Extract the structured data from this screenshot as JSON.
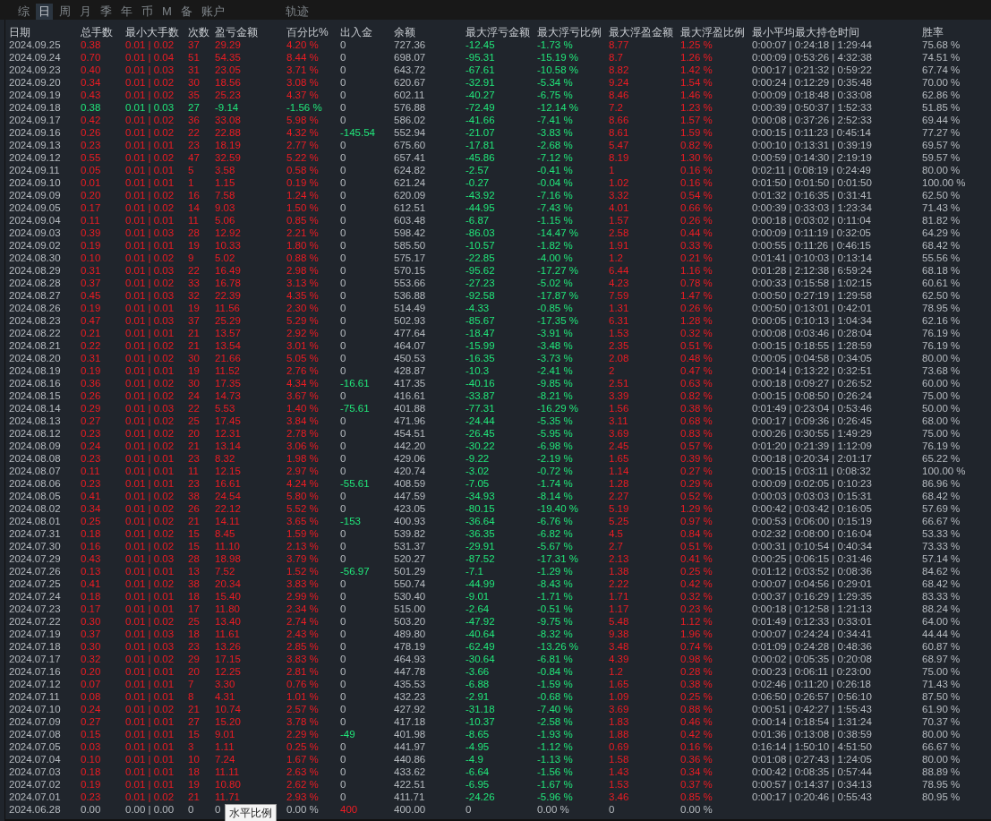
{
  "tabs": [
    {
      "label": "综",
      "selected": false
    },
    {
      "label": "日",
      "selected": true
    },
    {
      "label": "周",
      "selected": false
    },
    {
      "label": "月",
      "selected": false
    },
    {
      "label": "季",
      "selected": false
    },
    {
      "label": "年",
      "selected": false
    },
    {
      "label": "币",
      "selected": false
    },
    {
      "label": "M",
      "selected": false
    },
    {
      "label": "备",
      "selected": false
    },
    {
      "label": "账户",
      "selected": false
    },
    {
      "label": "轨迹",
      "selected": false
    }
  ],
  "table": {
    "columns": [
      "日期",
      "总手数",
      "最小大手数",
      "次数",
      "盈亏金额",
      "百分比%",
      "出入金",
      "余额",
      "最大浮亏金额",
      "最大浮亏比例",
      "最大浮盈金额",
      "最大浮盈比例",
      "最小平均最大持仓时间",
      "胜率"
    ],
    "rows": [
      {
        "loss": false,
        "flat": false,
        "withdrawal": false,
        "deposit": false,
        "cells": [
          "2024.09.25",
          "0.38",
          "0.01 | 0.02",
          "37",
          "29.29",
          "4.20 %",
          "0",
          "727.36",
          "-12.45",
          "-1.73 %",
          "8.77",
          "1.25 %",
          "0:00:07 | 0:24:18 | 1:29:44",
          "75.68 %"
        ]
      },
      {
        "loss": false,
        "flat": false,
        "withdrawal": false,
        "deposit": false,
        "cells": [
          "2024.09.24",
          "0.70",
          "0.01 | 0.04",
          "51",
          "54.35",
          "8.44 %",
          "0",
          "698.07",
          "-95.31",
          "-15.19 %",
          "8.7",
          "1.26 %",
          "0:00:09 | 0:53:26 | 4:32:38",
          "74.51 %"
        ]
      },
      {
        "loss": false,
        "flat": false,
        "withdrawal": false,
        "deposit": false,
        "cells": [
          "2024.09.23",
          "0.40",
          "0.01 | 0.03",
          "31",
          "23.05",
          "3.71 %",
          "0",
          "643.72",
          "-67.61",
          "-10.58 %",
          "8.82",
          "1.42 %",
          "0:00:17 | 0:21:32 | 0:59:22",
          "67.74 %"
        ]
      },
      {
        "loss": false,
        "flat": false,
        "withdrawal": false,
        "deposit": false,
        "cells": [
          "2024.09.20",
          "0.34",
          "0.01 | 0.02",
          "30",
          "18.56",
          "3.08 %",
          "0",
          "620.67",
          "-32.91",
          "-5.34 %",
          "9.24",
          "1.54 %",
          "0:00:24 | 0:12:29 | 0:35:48",
          "70.00 %"
        ]
      },
      {
        "loss": false,
        "flat": false,
        "withdrawal": false,
        "deposit": false,
        "cells": [
          "2024.09.19",
          "0.43",
          "0.01 | 0.02",
          "35",
          "25.23",
          "4.37 %",
          "0",
          "602.11",
          "-40.27",
          "-6.75 %",
          "8.46",
          "1.46 %",
          "0:00:09 | 0:18:48 | 0:33:08",
          "62.86 %"
        ]
      },
      {
        "loss": true,
        "flat": false,
        "withdrawal": false,
        "deposit": false,
        "cells": [
          "2024.09.18",
          "0.38",
          "0.01 | 0.03",
          "27",
          "-9.14",
          "-1.56 %",
          "0",
          "576.88",
          "-72.49",
          "-12.14 %",
          "7.2",
          "1.23 %",
          "0:00:39 | 0:50:37 | 1:52:33",
          "51.85 %"
        ]
      },
      {
        "loss": false,
        "flat": false,
        "withdrawal": false,
        "deposit": false,
        "cells": [
          "2024.09.17",
          "0.42",
          "0.01 | 0.02",
          "36",
          "33.08",
          "5.98 %",
          "0",
          "586.02",
          "-41.66",
          "-7.41 %",
          "8.66",
          "1.57 %",
          "0:00:08 | 0:37:26 | 2:52:33",
          "69.44 %"
        ]
      },
      {
        "loss": false,
        "flat": false,
        "withdrawal": true,
        "deposit": false,
        "cells": [
          "2024.09.16",
          "0.26",
          "0.01 | 0.02",
          "22",
          "22.88",
          "4.32 %",
          "-145.54",
          "552.94",
          "-21.07",
          "-3.83 %",
          "8.61",
          "1.59 %",
          "0:00:15 | 0:11:23 | 0:45:14",
          "77.27 %"
        ]
      },
      {
        "loss": false,
        "flat": false,
        "withdrawal": false,
        "deposit": false,
        "cells": [
          "2024.09.13",
          "0.23",
          "0.01 | 0.01",
          "23",
          "18.19",
          "2.77 %",
          "0",
          "675.60",
          "-17.81",
          "-2.68 %",
          "5.47",
          "0.82 %",
          "0:00:10 | 0:13:31 | 0:39:19",
          "69.57 %"
        ]
      },
      {
        "loss": false,
        "flat": false,
        "withdrawal": false,
        "deposit": false,
        "cells": [
          "2024.09.12",
          "0.55",
          "0.01 | 0.02",
          "47",
          "32.59",
          "5.22 %",
          "0",
          "657.41",
          "-45.86",
          "-7.12 %",
          "8.19",
          "1.30 %",
          "0:00:59 | 0:14:30 | 2:19:19",
          "59.57 %"
        ]
      },
      {
        "loss": false,
        "flat": false,
        "withdrawal": false,
        "deposit": false,
        "cells": [
          "2024.09.11",
          "0.05",
          "0.01 | 0.01",
          "5",
          "3.58",
          "0.58 %",
          "0",
          "624.82",
          "-2.57",
          "-0.41 %",
          "1",
          "0.16 %",
          "0:02:11 | 0:08:19 | 0:24:49",
          "80.00 %"
        ]
      },
      {
        "loss": false,
        "flat": false,
        "withdrawal": false,
        "deposit": false,
        "cells": [
          "2024.09.10",
          "0.01",
          "0.01 | 0.01",
          "1",
          "1.15",
          "0.19 %",
          "0",
          "621.24",
          "-0.27",
          "-0.04 %",
          "1.02",
          "0.16 %",
          "0:01:50 | 0:01:50 | 0:01:50",
          "100.00 %"
        ]
      },
      {
        "loss": false,
        "flat": false,
        "withdrawal": false,
        "deposit": false,
        "cells": [
          "2024.09.09",
          "0.20",
          "0.01 | 0.02",
          "16",
          "7.58",
          "1.24 %",
          "0",
          "620.09",
          "-43.92",
          "-7.16 %",
          "3.32",
          "0.54 %",
          "0:01:32 | 0:16:35 | 0:31:41",
          "62.50 %"
        ]
      },
      {
        "loss": false,
        "flat": false,
        "withdrawal": false,
        "deposit": false,
        "cells": [
          "2024.09.05",
          "0.17",
          "0.01 | 0.02",
          "14",
          "9.03",
          "1.50 %",
          "0",
          "612.51",
          "-44.95",
          "-7.43 %",
          "4.01",
          "0.66 %",
          "0:00:39 | 0:33:03 | 1:23:34",
          "71.43 %"
        ]
      },
      {
        "loss": false,
        "flat": false,
        "withdrawal": false,
        "deposit": false,
        "cells": [
          "2024.09.04",
          "0.11",
          "0.01 | 0.01",
          "11",
          "5.06",
          "0.85 %",
          "0",
          "603.48",
          "-6.87",
          "-1.15 %",
          "1.57",
          "0.26 %",
          "0:00:18 | 0:03:02 | 0:11:04",
          "81.82 %"
        ]
      },
      {
        "loss": false,
        "flat": false,
        "withdrawal": false,
        "deposit": false,
        "cells": [
          "2024.09.03",
          "0.39",
          "0.01 | 0.03",
          "28",
          "12.92",
          "2.21 %",
          "0",
          "598.42",
          "-86.03",
          "-14.47 %",
          "2.58",
          "0.44 %",
          "0:00:09 | 0:11:19 | 0:32:05",
          "64.29 %"
        ]
      },
      {
        "loss": false,
        "flat": false,
        "withdrawal": false,
        "deposit": false,
        "cells": [
          "2024.09.02",
          "0.19",
          "0.01 | 0.01",
          "19",
          "10.33",
          "1.80 %",
          "0",
          "585.50",
          "-10.57",
          "-1.82 %",
          "1.91",
          "0.33 %",
          "0:00:55 | 0:11:26 | 0:46:15",
          "68.42 %"
        ]
      },
      {
        "loss": false,
        "flat": false,
        "withdrawal": false,
        "deposit": false,
        "cells": [
          "2024.08.30",
          "0.10",
          "0.01 | 0.02",
          "9",
          "5.02",
          "0.88 %",
          "0",
          "575.17",
          "-22.85",
          "-4.00 %",
          "1.2",
          "0.21 %",
          "0:01:41 | 0:10:03 | 0:13:14",
          "55.56 %"
        ]
      },
      {
        "loss": false,
        "flat": false,
        "withdrawal": false,
        "deposit": false,
        "cells": [
          "2024.08.29",
          "0.31",
          "0.01 | 0.03",
          "22",
          "16.49",
          "2.98 %",
          "0",
          "570.15",
          "-95.62",
          "-17.27 %",
          "6.44",
          "1.16 %",
          "0:01:28 | 2:12:38 | 6:59:24",
          "68.18 %"
        ]
      },
      {
        "loss": false,
        "flat": false,
        "withdrawal": false,
        "deposit": false,
        "cells": [
          "2024.08.28",
          "0.37",
          "0.01 | 0.02",
          "33",
          "16.78",
          "3.13 %",
          "0",
          "553.66",
          "-27.23",
          "-5.02 %",
          "4.23",
          "0.78 %",
          "0:00:33 | 0:15:58 | 1:02:15",
          "60.61 %"
        ]
      },
      {
        "loss": false,
        "flat": false,
        "withdrawal": false,
        "deposit": false,
        "cells": [
          "2024.08.27",
          "0.45",
          "0.01 | 0.03",
          "32",
          "22.39",
          "4.35 %",
          "0",
          "536.88",
          "-92.58",
          "-17.87 %",
          "7.59",
          "1.47 %",
          "0:00:50 | 0:27:19 | 1:29:58",
          "62.50 %"
        ]
      },
      {
        "loss": false,
        "flat": false,
        "withdrawal": false,
        "deposit": false,
        "cells": [
          "2024.08.26",
          "0.19",
          "0.01 | 0.01",
          "19",
          "11.56",
          "2.30 %",
          "0",
          "514.49",
          "-4.33",
          "-0.85 %",
          "1.31",
          "0.26 %",
          "0:00:50 | 0:13:01 | 0:42:01",
          "78.95 %"
        ]
      },
      {
        "loss": false,
        "flat": false,
        "withdrawal": false,
        "deposit": false,
        "cells": [
          "2024.08.23",
          "0.47",
          "0.01 | 0.03",
          "37",
          "25.29",
          "5.29 %",
          "0",
          "502.93",
          "-85.67",
          "-17.35 %",
          "6.31",
          "1.28 %",
          "0:00:05 | 0:10:13 | 1:04:34",
          "62.16 %"
        ]
      },
      {
        "loss": false,
        "flat": false,
        "withdrawal": false,
        "deposit": false,
        "cells": [
          "2024.08.22",
          "0.21",
          "0.01 | 0.01",
          "21",
          "13.57",
          "2.92 %",
          "0",
          "477.64",
          "-18.47",
          "-3.91 %",
          "1.53",
          "0.32 %",
          "0:00:08 | 0:03:46 | 0:28:04",
          "76.19 %"
        ]
      },
      {
        "loss": false,
        "flat": false,
        "withdrawal": false,
        "deposit": false,
        "cells": [
          "2024.08.21",
          "0.22",
          "0.01 | 0.02",
          "21",
          "13.54",
          "3.01 %",
          "0",
          "464.07",
          "-15.99",
          "-3.48 %",
          "2.35",
          "0.51 %",
          "0:00:15 | 0:18:55 | 1:28:59",
          "76.19 %"
        ]
      },
      {
        "loss": false,
        "flat": false,
        "withdrawal": false,
        "deposit": false,
        "cells": [
          "2024.08.20",
          "0.31",
          "0.01 | 0.02",
          "30",
          "21.66",
          "5.05 %",
          "0",
          "450.53",
          "-16.35",
          "-3.73 %",
          "2.08",
          "0.48 %",
          "0:00:05 | 0:04:58 | 0:34:05",
          "80.00 %"
        ]
      },
      {
        "loss": false,
        "flat": false,
        "withdrawal": false,
        "deposit": false,
        "cells": [
          "2024.08.19",
          "0.19",
          "0.01 | 0.01",
          "19",
          "11.52",
          "2.76 %",
          "0",
          "428.87",
          "-10.3",
          "-2.41 %",
          "2",
          "0.47 %",
          "0:00:14 | 0:13:22 | 0:32:51",
          "73.68 %"
        ]
      },
      {
        "loss": false,
        "flat": false,
        "withdrawal": true,
        "deposit": false,
        "cells": [
          "2024.08.16",
          "0.36",
          "0.01 | 0.02",
          "30",
          "17.35",
          "4.34 %",
          "-16.61",
          "417.35",
          "-40.16",
          "-9.85 %",
          "2.51",
          "0.63 %",
          "0:00:18 | 0:09:27 | 0:26:52",
          "60.00 %"
        ]
      },
      {
        "loss": false,
        "flat": false,
        "withdrawal": false,
        "deposit": false,
        "cells": [
          "2024.08.15",
          "0.26",
          "0.01 | 0.02",
          "24",
          "14.73",
          "3.67 %",
          "0",
          "416.61",
          "-33.87",
          "-8.21 %",
          "3.39",
          "0.82 %",
          "0:00:15 | 0:08:50 | 0:26:24",
          "75.00 %"
        ]
      },
      {
        "loss": false,
        "flat": false,
        "withdrawal": true,
        "deposit": false,
        "cells": [
          "2024.08.14",
          "0.29",
          "0.01 | 0.03",
          "22",
          "5.53",
          "1.40 %",
          "-75.61",
          "401.88",
          "-77.31",
          "-16.29 %",
          "1.56",
          "0.38 %",
          "0:01:49 | 0:23:04 | 0:53:46",
          "50.00 %"
        ]
      },
      {
        "loss": false,
        "flat": false,
        "withdrawal": false,
        "deposit": false,
        "cells": [
          "2024.08.13",
          "0.27",
          "0.01 | 0.02",
          "25",
          "17.45",
          "3.84 %",
          "0",
          "471.96",
          "-24.44",
          "-5.35 %",
          "3.11",
          "0.68 %",
          "0:00:17 | 0:09:36 | 0:26:45",
          "68.00 %"
        ]
      },
      {
        "loss": false,
        "flat": false,
        "withdrawal": false,
        "deposit": false,
        "cells": [
          "2024.08.12",
          "0.23",
          "0.01 | 0.02",
          "20",
          "12.31",
          "2.78 %",
          "0",
          "454.51",
          "-26.45",
          "-5.95 %",
          "3.69",
          "0.83 %",
          "0:00:26 | 0:30:55 | 1:49:29",
          "75.00 %"
        ]
      },
      {
        "loss": false,
        "flat": false,
        "withdrawal": false,
        "deposit": false,
        "cells": [
          "2024.08.09",
          "0.24",
          "0.01 | 0.02",
          "21",
          "13.14",
          "3.06 %",
          "0",
          "442.20",
          "-30.22",
          "-6.98 %",
          "2.45",
          "0.57 %",
          "0:01:20 | 0:21:39 | 1:12:09",
          "76.19 %"
        ]
      },
      {
        "loss": false,
        "flat": false,
        "withdrawal": false,
        "deposit": false,
        "cells": [
          "2024.08.08",
          "0.23",
          "0.01 | 0.01",
          "23",
          "8.32",
          "1.98 %",
          "0",
          "429.06",
          "-9.22",
          "-2.19 %",
          "1.65",
          "0.39 %",
          "0:00:18 | 0:20:34 | 2:01:17",
          "65.22 %"
        ]
      },
      {
        "loss": false,
        "flat": false,
        "withdrawal": false,
        "deposit": false,
        "cells": [
          "2024.08.07",
          "0.11",
          "0.01 | 0.01",
          "11",
          "12.15",
          "2.97 %",
          "0",
          "420.74",
          "-3.02",
          "-0.72 %",
          "1.14",
          "0.27 %",
          "0:00:15 | 0:03:11 | 0:08:32",
          "100.00 %"
        ]
      },
      {
        "loss": false,
        "flat": false,
        "withdrawal": true,
        "deposit": false,
        "cells": [
          "2024.08.06",
          "0.23",
          "0.01 | 0.01",
          "23",
          "16.61",
          "4.24 %",
          "-55.61",
          "408.59",
          "-7.05",
          "-1.74 %",
          "1.28",
          "0.29 %",
          "0:00:09 | 0:02:05 | 0:10:23",
          "86.96 %"
        ]
      },
      {
        "loss": false,
        "flat": false,
        "withdrawal": false,
        "deposit": false,
        "cells": [
          "2024.08.05",
          "0.41",
          "0.01 | 0.02",
          "38",
          "24.54",
          "5.80 %",
          "0",
          "447.59",
          "-34.93",
          "-8.14 %",
          "2.27",
          "0.52 %",
          "0:00:03 | 0:03:03 | 0:15:31",
          "68.42 %"
        ]
      },
      {
        "loss": false,
        "flat": false,
        "withdrawal": false,
        "deposit": false,
        "cells": [
          "2024.08.02",
          "0.34",
          "0.01 | 0.02",
          "26",
          "22.12",
          "5.52 %",
          "0",
          "423.05",
          "-80.15",
          "-19.40 %",
          "5.19",
          "1.29 %",
          "0:00:42 | 0:03:42 | 0:16:05",
          "57.69 %"
        ]
      },
      {
        "loss": false,
        "flat": false,
        "withdrawal": true,
        "deposit": false,
        "cells": [
          "2024.08.01",
          "0.25",
          "0.01 | 0.02",
          "21",
          "14.11",
          "3.65 %",
          "-153",
          "400.93",
          "-36.64",
          "-6.76 %",
          "5.25",
          "0.97 %",
          "0:00:53 | 0:06:00 | 0:15:19",
          "66.67 %"
        ]
      },
      {
        "loss": false,
        "flat": false,
        "withdrawal": false,
        "deposit": false,
        "cells": [
          "2024.07.31",
          "0.18",
          "0.01 | 0.02",
          "15",
          "8.45",
          "1.59 %",
          "0",
          "539.82",
          "-36.35",
          "-6.82 %",
          "4.5",
          "0.84 %",
          "0:02:32 | 0:08:00 | 0:16:04",
          "53.33 %"
        ]
      },
      {
        "loss": false,
        "flat": false,
        "withdrawal": false,
        "deposit": false,
        "cells": [
          "2024.07.30",
          "0.16",
          "0.01 | 0.02",
          "15",
          "11.10",
          "2.13 %",
          "0",
          "531.37",
          "-29.91",
          "-5.67 %",
          "2.7",
          "0.51 %",
          "0:00:31 | 0:10:54 | 0:40:34",
          "73.33 %"
        ]
      },
      {
        "loss": false,
        "flat": false,
        "withdrawal": false,
        "deposit": false,
        "cells": [
          "2024.07.29",
          "0.43",
          "0.01 | 0.03",
          "28",
          "18.98",
          "3.79 %",
          "0",
          "520.27",
          "-87.52",
          "-17.31 %",
          "2.13",
          "0.41 %",
          "0:00:25 | 0:06:15 | 0:31:46",
          "57.14 %"
        ]
      },
      {
        "loss": false,
        "flat": false,
        "withdrawal": true,
        "deposit": false,
        "cells": [
          "2024.07.26",
          "0.13",
          "0.01 | 0.01",
          "13",
          "7.52",
          "1.52 %",
          "-56.97",
          "501.29",
          "-7.1",
          "-1.29 %",
          "1.38",
          "0.25 %",
          "0:01:12 | 0:03:52 | 0:08:36",
          "84.62 %"
        ]
      },
      {
        "loss": false,
        "flat": false,
        "withdrawal": false,
        "deposit": false,
        "cells": [
          "2024.07.25",
          "0.41",
          "0.01 | 0.02",
          "38",
          "20.34",
          "3.83 %",
          "0",
          "550.74",
          "-44.99",
          "-8.43 %",
          "2.22",
          "0.42 %",
          "0:00:07 | 0:04:56 | 0:29:01",
          "68.42 %"
        ]
      },
      {
        "loss": false,
        "flat": false,
        "withdrawal": false,
        "deposit": false,
        "cells": [
          "2024.07.24",
          "0.18",
          "0.01 | 0.01",
          "18",
          "15.40",
          "2.99 %",
          "0",
          "530.40",
          "-9.01",
          "-1.71 %",
          "1.71",
          "0.32 %",
          "0:00:37 | 0:16:29 | 1:29:35",
          "83.33 %"
        ]
      },
      {
        "loss": false,
        "flat": false,
        "withdrawal": false,
        "deposit": false,
        "cells": [
          "2024.07.23",
          "0.17",
          "0.01 | 0.01",
          "17",
          "11.80",
          "2.34 %",
          "0",
          "515.00",
          "-2.64",
          "-0.51 %",
          "1.17",
          "0.23 %",
          "0:00:18 | 0:12:58 | 1:21:13",
          "88.24 %"
        ]
      },
      {
        "loss": false,
        "flat": false,
        "withdrawal": false,
        "deposit": false,
        "cells": [
          "2024.07.22",
          "0.30",
          "0.01 | 0.02",
          "25",
          "13.40",
          "2.74 %",
          "0",
          "503.20",
          "-47.92",
          "-9.75 %",
          "5.48",
          "1.12 %",
          "0:01:49 | 0:12:33 | 0:33:01",
          "64.00 %"
        ]
      },
      {
        "loss": false,
        "flat": false,
        "withdrawal": false,
        "deposit": false,
        "cells": [
          "2024.07.19",
          "0.37",
          "0.01 | 0.03",
          "18",
          "11.61",
          "2.43 %",
          "0",
          "489.80",
          "-40.64",
          "-8.32 %",
          "9.38",
          "1.96 %",
          "0:00:07 | 0:24:24 | 0:34:41",
          "44.44 %"
        ]
      },
      {
        "loss": false,
        "flat": false,
        "withdrawal": false,
        "deposit": false,
        "cells": [
          "2024.07.18",
          "0.30",
          "0.01 | 0.03",
          "23",
          "13.26",
          "2.85 %",
          "0",
          "478.19",
          "-62.49",
          "-13.26 %",
          "3.48",
          "0.74 %",
          "0:01:09 | 0:24:28 | 0:48:36",
          "60.87 %"
        ]
      },
      {
        "loss": false,
        "flat": false,
        "withdrawal": false,
        "deposit": false,
        "cells": [
          "2024.07.17",
          "0.32",
          "0.01 | 0.02",
          "29",
          "17.15",
          "3.83 %",
          "0",
          "464.93",
          "-30.64",
          "-6.81 %",
          "4.39",
          "0.98 %",
          "0:00:02 | 0:05:35 | 0:20:08",
          "68.97 %"
        ]
      },
      {
        "loss": false,
        "flat": false,
        "withdrawal": false,
        "deposit": false,
        "cells": [
          "2024.07.16",
          "0.20",
          "0.01 | 0.01",
          "20",
          "12.25",
          "2.81 %",
          "0",
          "447.78",
          "-3.66",
          "-0.84 %",
          "1.2",
          "0.28 %",
          "0:00:23 | 0:06:11 | 0:23:00",
          "75.00 %"
        ]
      },
      {
        "loss": false,
        "flat": false,
        "withdrawal": false,
        "deposit": false,
        "cells": [
          "2024.07.12",
          "0.07",
          "0.01 | 0.01",
          "7",
          "3.30",
          "0.76 %",
          "0",
          "435.53",
          "-6.88",
          "-1.59 %",
          "1.65",
          "0.38 %",
          "0:02:46 | 0:11:20 | 0:26:18",
          "71.43 %"
        ]
      },
      {
        "loss": false,
        "flat": false,
        "withdrawal": false,
        "deposit": false,
        "cells": [
          "2024.07.11",
          "0.08",
          "0.01 | 0.01",
          "8",
          "4.31",
          "1.01 %",
          "0",
          "432.23",
          "-2.91",
          "-0.68 %",
          "1.09",
          "0.25 %",
          "0:06:50 | 0:26:57 | 0:56:10",
          "87.50 %"
        ]
      },
      {
        "loss": false,
        "flat": false,
        "withdrawal": false,
        "deposit": false,
        "cells": [
          "2024.07.10",
          "0.24",
          "0.01 | 0.02",
          "21",
          "10.74",
          "2.57 %",
          "0",
          "427.92",
          "-31.18",
          "-7.40 %",
          "3.69",
          "0.88 %",
          "0:00:51 | 0:42:27 | 1:55:43",
          "61.90 %"
        ]
      },
      {
        "loss": false,
        "flat": false,
        "withdrawal": false,
        "deposit": false,
        "cells": [
          "2024.07.09",
          "0.27",
          "0.01 | 0.01",
          "27",
          "15.20",
          "3.78 %",
          "0",
          "417.18",
          "-10.37",
          "-2.58 %",
          "1.83",
          "0.46 %",
          "0:00:14 | 0:18:54 | 1:31:24",
          "70.37 %"
        ]
      },
      {
        "loss": false,
        "flat": false,
        "withdrawal": true,
        "deposit": false,
        "cells": [
          "2024.07.08",
          "0.15",
          "0.01 | 0.01",
          "15",
          "9.01",
          "2.29 %",
          "-49",
          "401.98",
          "-8.65",
          "-1.93 %",
          "1.88",
          "0.42 %",
          "0:01:36 | 0:13:08 | 0:38:59",
          "80.00 %"
        ]
      },
      {
        "loss": false,
        "flat": false,
        "withdrawal": false,
        "deposit": false,
        "cells": [
          "2024.07.05",
          "0.03",
          "0.01 | 0.01",
          "3",
          "1.11",
          "0.25 %",
          "0",
          "441.97",
          "-4.95",
          "-1.12 %",
          "0.69",
          "0.16 %",
          "0:16:14 | 1:50:10 | 4:51:50",
          "66.67 %"
        ]
      },
      {
        "loss": false,
        "flat": false,
        "withdrawal": false,
        "deposit": false,
        "cells": [
          "2024.07.04",
          "0.10",
          "0.01 | 0.01",
          "10",
          "7.24",
          "1.67 %",
          "0",
          "440.86",
          "-4.9",
          "-1.13 %",
          "1.58",
          "0.36 %",
          "0:01:08 | 0:27:43 | 1:24:05",
          "80.00 %"
        ]
      },
      {
        "loss": false,
        "flat": false,
        "withdrawal": false,
        "deposit": false,
        "cells": [
          "2024.07.03",
          "0.18",
          "0.01 | 0.01",
          "18",
          "11.11",
          "2.63 %",
          "0",
          "433.62",
          "-6.64",
          "-1.56 %",
          "1.43",
          "0.34 %",
          "0:00:42 | 0:08:35 | 0:57:44",
          "88.89 %"
        ]
      },
      {
        "loss": false,
        "flat": false,
        "withdrawal": false,
        "deposit": false,
        "cells": [
          "2024.07.02",
          "0.19",
          "0.01 | 0.01",
          "19",
          "10.80",
          "2.62 %",
          "0",
          "422.51",
          "-6.95",
          "-1.67 %",
          "1.53",
          "0.37 %",
          "0:00:57 | 0:14:37 | 0:34:13",
          "78.95 %"
        ]
      },
      {
        "loss": false,
        "flat": false,
        "withdrawal": false,
        "deposit": false,
        "cells": [
          "2024.07.01",
          "0.23",
          "0.01 | 0.02",
          "21",
          "11.71",
          "2.93 %",
          "0",
          "411.71",
          "-24.26",
          "-5.96 %",
          "3.46",
          "0.85 %",
          "0:00:17 | 0:20:46 | 0:55:43",
          "80.95 %"
        ]
      },
      {
        "loss": false,
        "flat": true,
        "withdrawal": false,
        "deposit": true,
        "cells": [
          "2024.06.28",
          "0.00",
          "0.00 | 0.00",
          "0",
          "0",
          "0.00 %",
          "400",
          "400.00",
          "0",
          "0.00 %",
          "0",
          "0.00 %"
        ]
      }
    ]
  },
  "tooltip": {
    "text": "水平比例"
  }
}
